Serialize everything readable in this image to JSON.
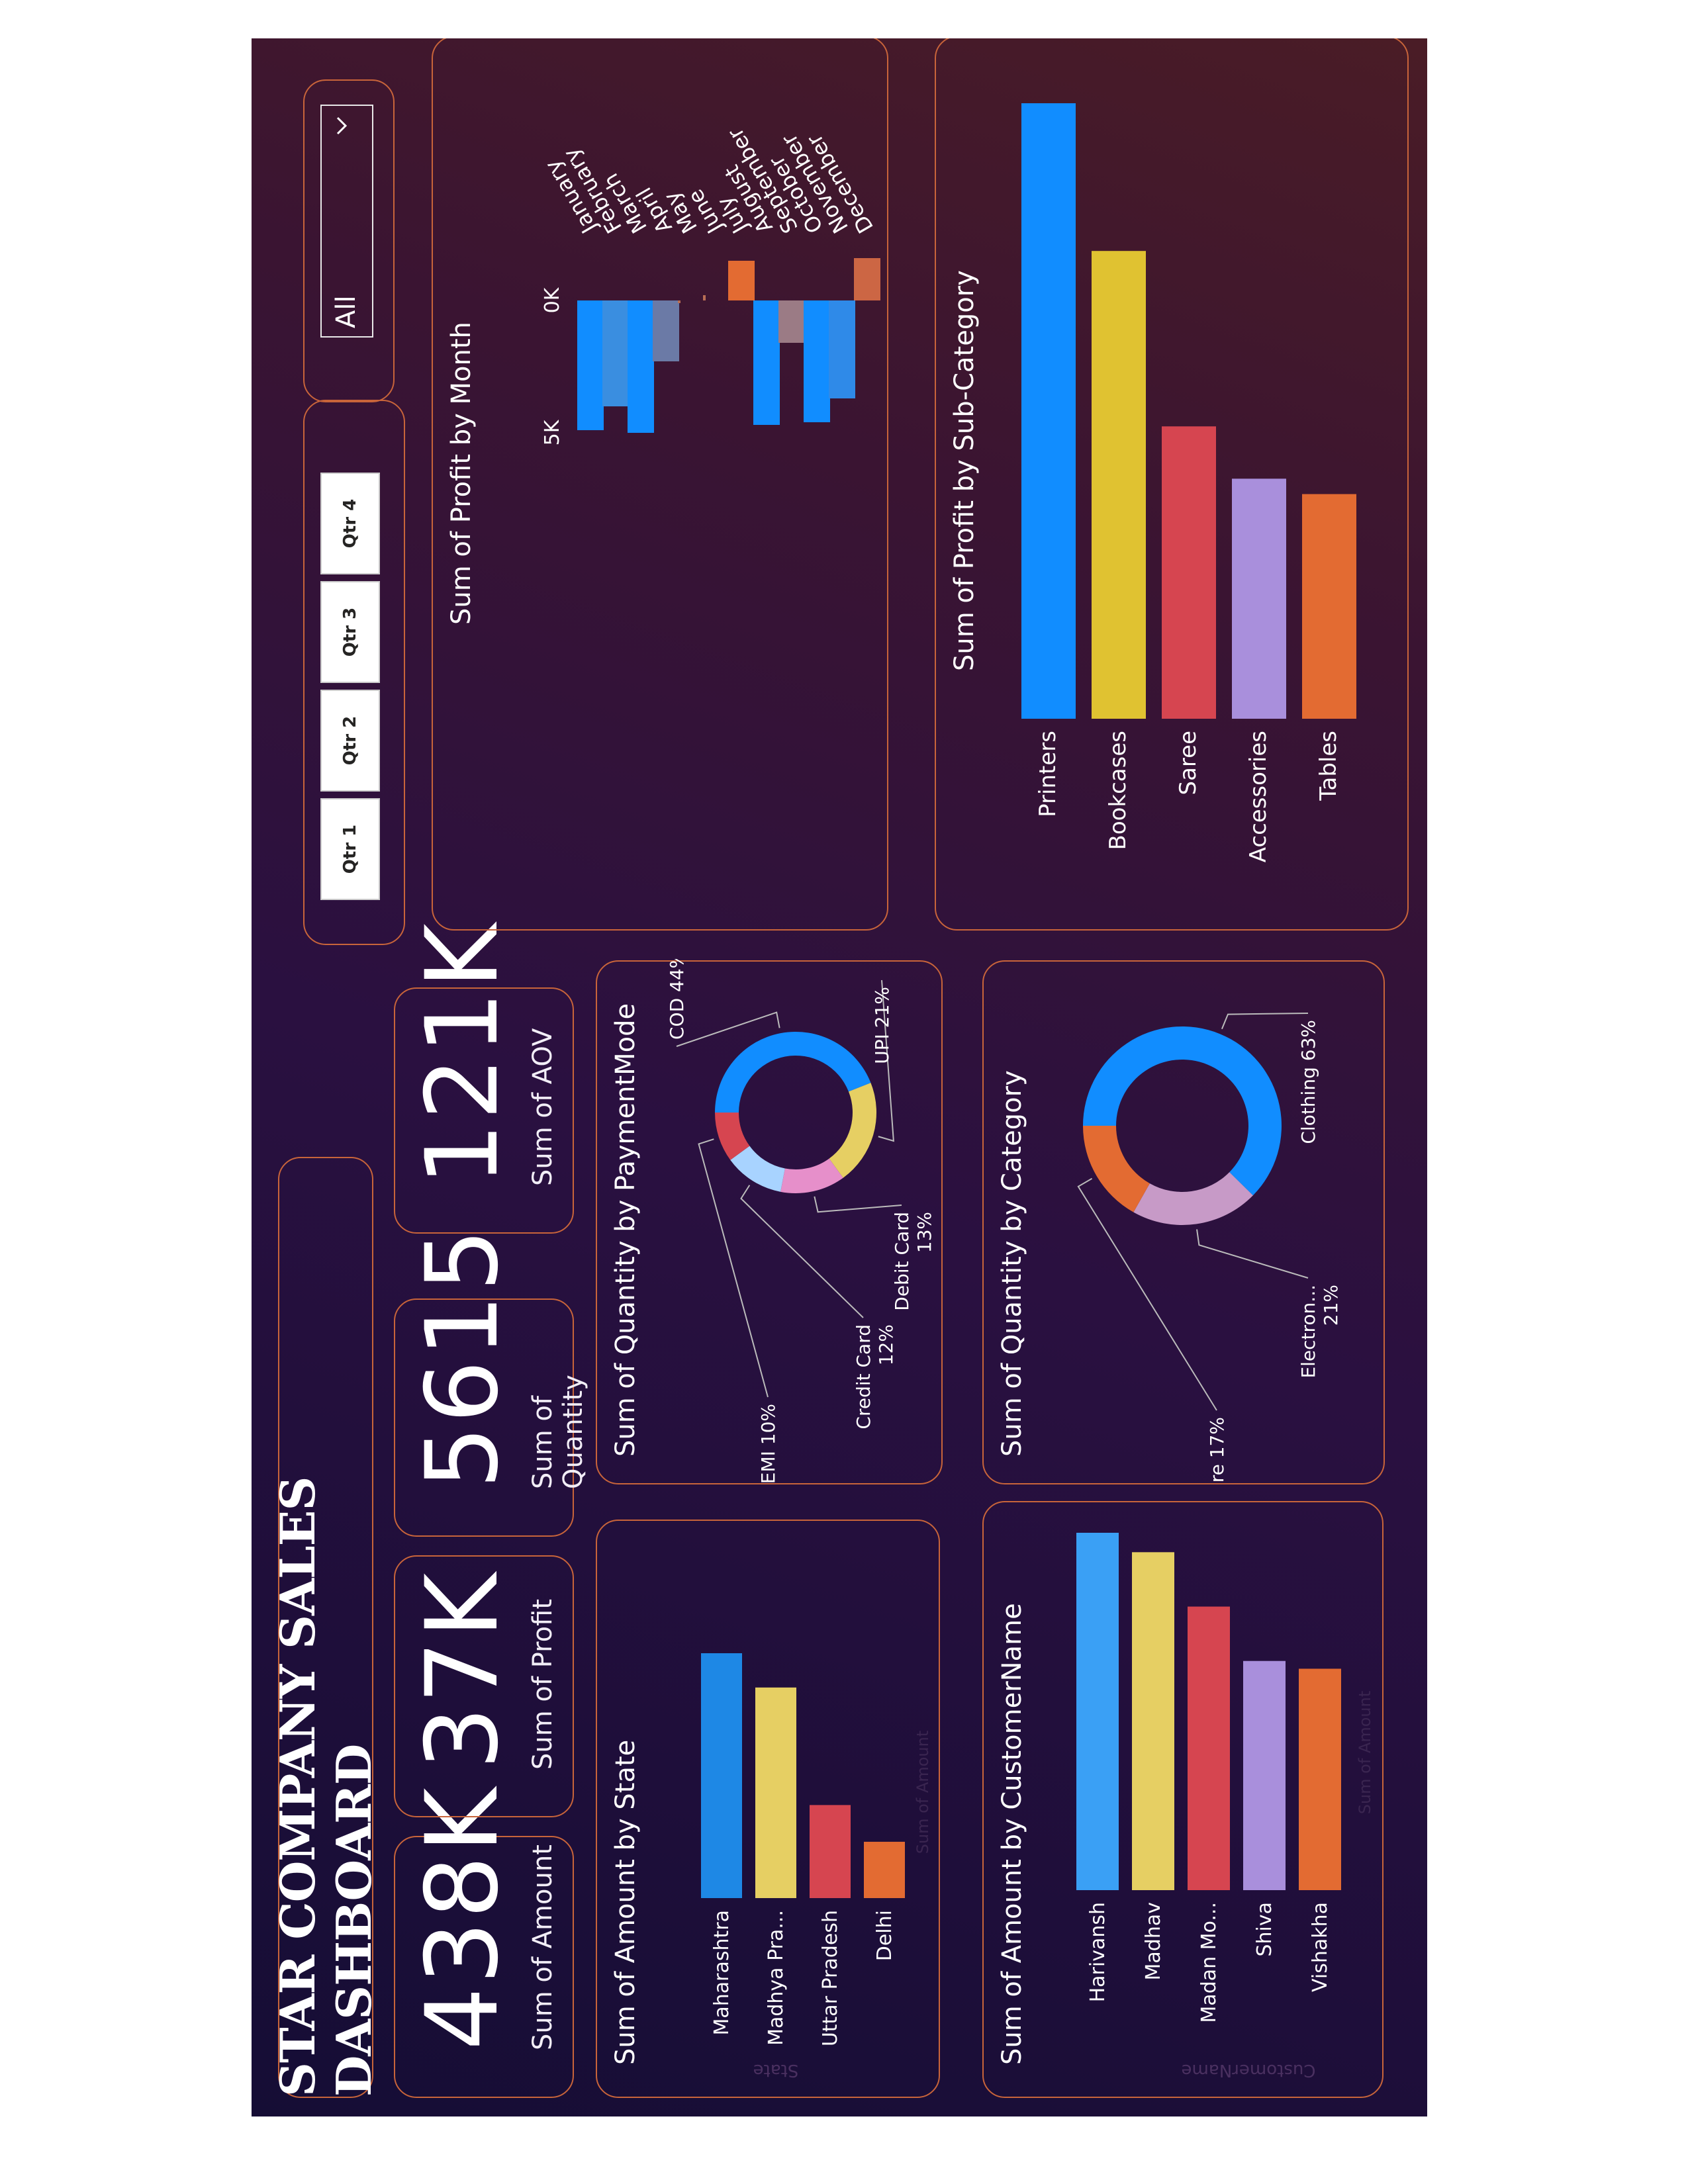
{
  "title": "STAR COMPANY SALES DASHBOARD",
  "kpis": [
    {
      "value": "438K",
      "label": "Sum of Amount"
    },
    {
      "value": "37K",
      "label": "Sum of Profit"
    },
    {
      "value": "5615",
      "label": "Sum of Quantity"
    },
    {
      "value": "121K",
      "label": "Sum of AOV"
    }
  ],
  "slicers": {
    "quarters": [
      "Qtr 1",
      "Qtr 2",
      "Qtr 3",
      "Qtr 4"
    ],
    "dropdown_value": "All"
  },
  "state_axis_hint": "State",
  "customer_axis_hint": "CustomerName",
  "state_value_hint": "Sum of Amount",
  "customer_value_hint": "Sum of Amount",
  "colors": {
    "blue": "#1e88e5",
    "yellow": "#e6cf63",
    "red": "#d64550",
    "purple": "#a98fdc",
    "orange": "#e36b32"
  },
  "chart_data": [
    {
      "type": "bar",
      "title": "Sum of Amount by State",
      "categories": [
        "Maharashtra",
        "Madhya Pra...",
        "Uttar Pradesh",
        "Delhi"
      ],
      "values": [
        100000,
        86000,
        38000,
        23000
      ],
      "colors": [
        "#1e88e5",
        "#e6cf63",
        "#d64550",
        "#e36b32"
      ]
    },
    {
      "type": "bar",
      "title": "Sum of Amount by CustomerName",
      "categories": [
        "Harivansh",
        "Madhav",
        "Madan Mo...",
        "Shiva",
        "Vishakha"
      ],
      "values": [
        9200,
        8700,
        7300,
        5900,
        5700
      ],
      "colors": [
        "#3aa0f5",
        "#e6cf63",
        "#d64550",
        "#a98fdc",
        "#e36b32"
      ]
    },
    {
      "type": "pie",
      "title": "Sum of Quantity by PaymentMode",
      "labels": [
        "COD",
        "UPI",
        "Debit Card",
        "Credit Card",
        "EMI"
      ],
      "values": [
        44,
        21,
        13,
        12,
        10
      ],
      "colors": [
        "#118dff",
        "#e6cf63",
        "#e68fca",
        "#a8d3ff",
        "#d64550"
      ]
    },
    {
      "type": "pie",
      "title": "Sum of Quantity by Category",
      "labels": [
        "Clothing",
        "Electron...",
        "Furniture"
      ],
      "values": [
        63,
        21,
        17
      ],
      "colors": [
        "#118dff",
        "#c79ac7",
        "#e36b32"
      ]
    },
    {
      "type": "bar",
      "title": "Sum of Profit by Month",
      "categories": [
        "January",
        "February",
        "March",
        "April",
        "May",
        "June",
        "July",
        "August",
        "September",
        "October",
        "November",
        "December"
      ],
      "values": [
        4900,
        4000,
        5000,
        2300,
        100,
        -200,
        -1500,
        4700,
        1600,
        4600,
        3700,
        -1600
      ],
      "colors": [
        "#118dff",
        "#3a8ee0",
        "#118dff",
        "#6b7aa6",
        "#b86e54",
        "#b86e54",
        "#e36b32",
        "#118dff",
        "#9b7b85",
        "#118dff",
        "#2f8ae8",
        "#cc6644"
      ],
      "yticks": [
        "0K",
        "5K"
      ]
    },
    {
      "type": "bar",
      "title": "Sum of Profit by Sub-Category",
      "categories": [
        "Printers",
        "Bookcases",
        "Saree",
        "Accessories",
        "Tables"
      ],
      "values": [
        10000,
        7600,
        4750,
        3900,
        3650
      ],
      "colors": [
        "#118dff",
        "#e0c231",
        "#d64550",
        "#a98fdc",
        "#e36b32"
      ]
    }
  ]
}
